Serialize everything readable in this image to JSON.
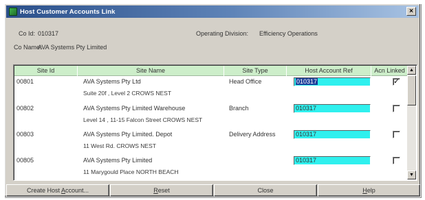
{
  "window": {
    "title": "Host Customer Accounts Link",
    "close_glyph": "×",
    "icon": "app-icon"
  },
  "header": {
    "co_id_label": "Co Id:",
    "co_id_value": "010317",
    "co_name_label": "Co Name:",
    "co_name_value": "AVA Systems Pty Limited",
    "division_label": "Operating Division:",
    "division_value": "Efficiency Operations"
  },
  "grid": {
    "columns": [
      "Site Id",
      "Site Name",
      "Site Type",
      "Host Account Ref",
      "Acn Linked"
    ],
    "rows": [
      {
        "site_id": "00801",
        "site_name": "AVA Systems Pty Ltd",
        "address": "Suite 20f , Level 2    CROWS NEST",
        "site_type": "Head Office",
        "account_ref": "010317",
        "selected": true,
        "linked": true,
        "check_glyph": "✓"
      },
      {
        "site_id": "00802",
        "site_name": "AVA Systems Pty Limited Warehouse",
        "address": "Level 14 , 11-15 Falcon Street    CROWS NEST",
        "site_type": "Branch",
        "account_ref": "010317",
        "selected": false,
        "linked": false,
        "check_glyph": ""
      },
      {
        "site_id": "00803",
        "site_name": "AVA Systems Pty Limited. Depot",
        "address": "11 West Rd.    CROWS NEST",
        "site_type": "Delivery Address",
        "account_ref": "010317",
        "selected": false,
        "linked": false,
        "check_glyph": ""
      },
      {
        "site_id": "00805",
        "site_name": "AVA Systems Pty Limited",
        "address": "11 Marygould Place    NORTH BEACH",
        "site_type": "",
        "account_ref": "010317",
        "selected": false,
        "linked": false,
        "check_glyph": ""
      }
    ],
    "scroll_up_glyph": "▲",
    "scroll_down_glyph": "▼"
  },
  "buttons": {
    "create": {
      "pre": "Create Host ",
      "ul": "A",
      "post": "ccount..."
    },
    "reset": {
      "pre": "",
      "ul": "R",
      "post": "eset"
    },
    "close": {
      "pre": "Close",
      "ul": "",
      "post": ""
    },
    "help": {
      "pre": "",
      "ul": "H",
      "post": "elp"
    }
  },
  "colors": {
    "header_bg": "#cdeeca",
    "account_field": "#2ff0ee",
    "selection": "#1c3f9a"
  }
}
